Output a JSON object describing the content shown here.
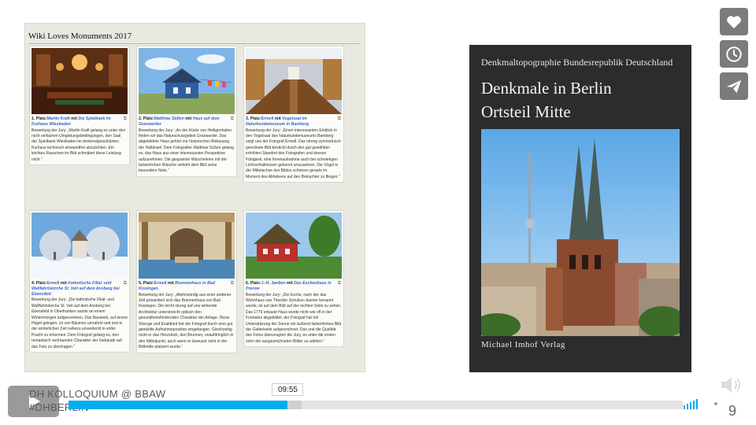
{
  "slide": {
    "panel_title": "Wiki Loves Monuments 2017",
    "cards": [
      {
        "rank": "1. Platz:",
        "author": "Martin Kraft",
        "mid": " mit ",
        "work": "Die Spielbank im Kurhaus Wiesbaden",
        "body": "Bewertung der Jury: „Martin Kraft gelang es unter den nicht einfachen Umgebungsbedingungen, den Saal der Spielbank Wiesbaden im denkmalgeschützten Kurhaus technisch einwandfrei abzulichten. Ein leichtes Rauschen im Bild schmälert diese Leistung nicht.“"
      },
      {
        "rank": "2. Platz:",
        "author": "Matthias Süßen",
        "mid": " mit ",
        "work": "Haus auf dem Graswarder",
        "body": "Bewertung der Jury: „An der Küste von Heiligenhafen finden wir das Naturschutzgebiet Graswarder. Das abgebildete Haus gehört zur historischen Bebauung der Halbinsel. Dem Fotografen Matthias Süßen gelang es, das Haus aus einer interessanten Perspektive aufzunehmen. Die gespannte Wäscheleine mit der farbenfrohen Wäsche verleiht dem Bild seine besondere Note.“"
      },
      {
        "rank": "3. Platz:",
        "author": "Ermell",
        "mid": " mit ",
        "work": "Vogelsaal im Naturkundemuseum in Bamberg",
        "body": "Bewertung der Jury: „Einen interessanten Einblick in den Vogelsaal des Naturkundemuseums Bamberg zeigt uns der Fotograf Ermell. Das streng symmetrisch geordnete Bild besticht durch den gut gewählten erhöhten Standort des Fotografen und dessen Fähigkeit, eine Innenaufnahme auch bei schwierigen Lichtverhältnissen gekonnt umzusetzen. Die Vögel in der Mittelachse des Bildes scheinen gerade im Moment des Abhebens auf den Betrachter zu fliegen.“"
      },
      {
        "rank": "4. Platz:",
        "author": "Ermell",
        "mid": " mit ",
        "work": "Katholische Filial- und Wallfahrtskirche St. Veit auf dem Ansberg bei Ebensfeld",
        "body": "Bewertung der Jury: „Die katholische Filial- und Wallfahrtskirche St. Veit auf dem Ansberg bei Ebensfeld in Oberfranken wurde an einem Wintermorgen aufgenommen. Das Bauwerk, auf einem Hügel gelegen, ist von Bäumen umrahmt und erst in der winterlichen Zeit nahezu unverdeckt in voller Pracht zu erkennen. Dem Fotograf gelang es, den romantisch verträumten Charakter der Gebäude auf das Foto zu übertragen.“"
      },
      {
        "rank": "5. Platz:",
        "author": "Ermell",
        "mid": " mit ",
        "work": "Brunnenhaus in Bad Kissingen",
        "body": "Bewertung der Jury: „Altehrwürdig aus einer anderen Zeit präsentiert sich das Brunnenhaus von Bad Kissingen. Die leicht streng auf uns wirkende Architektur unterstreicht optisch den gesundheitsfördernden Charakter der Anlage. Diese Strenge und Exaktheit hat der Fotograf durch eine gut gewählte Aufnahmeposition eingefangen. Gleichzeitig rückt er das Herzstück, den Brunnen, unaufdringlich in den Mittelpunkt, auch wenn er bewusst nicht in der Bildmitte platziert wurde.“"
      },
      {
        "rank": "6. Platz:",
        "author": "J.-H. Janßen",
        "mid": " mit ",
        "work": "Das Eschenhaus in Prerow",
        "body": "Bewertung der Jury: „Die Esche, nach der das Wohnhaus von Theodor Schultze-Jasmer benannt wurde, ist auf dem Bild auf der rechten Seite zu sehen. Das 1779 erbaute Haus wurde nicht wie oft in der Frontalen abgebildet, der Fotograf hat mit Unterstützung der Sonne ein äußerst farbenfrohes Bild der Giebelseite aufgezeichnet. Das und die Qualität des Fotos überzeugten die Jury, es unter die ersten zehn der ausgezeichneten Bilder zu wählen.“"
      }
    ]
  },
  "book": {
    "series": "Denkmaltopographie Bundesrepublik Deutschland",
    "title_line1": "Denkmale in Berlin",
    "title_line2": "Ortsteil Mitte",
    "publisher": "Michael Imhof Verlag"
  },
  "side_buttons": [
    {
      "name": "like-button",
      "icon": "heart-icon"
    },
    {
      "name": "watch-later-button",
      "icon": "clock-icon"
    },
    {
      "name": "share-button",
      "icon": "paper-plane-icon"
    }
  ],
  "player": {
    "title_line1": "DH KOLLOQUIUM @ BBAW",
    "title_line2": "#DHBERLIN",
    "time_tooltip": "09:55",
    "progress_fraction": 0.357,
    "loaded_fraction": 0.38,
    "accent_color": "#00adef"
  },
  "corner_text": "9"
}
